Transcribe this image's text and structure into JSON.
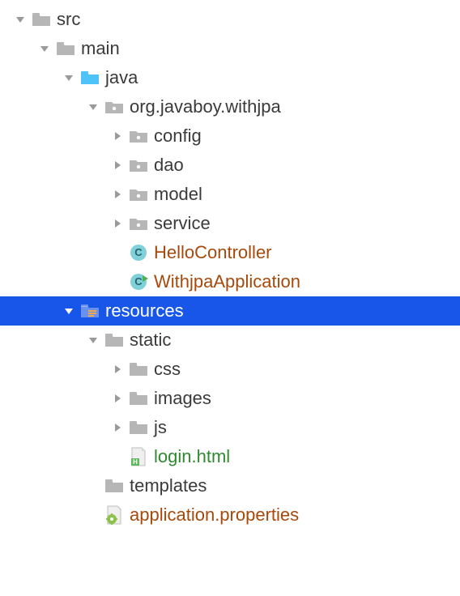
{
  "indent_unit": 30,
  "colors": {
    "selected_bg": "#1756e8",
    "java_class": "#a8490c",
    "html_file": "#2f8a2f",
    "props_file": "#a8490c",
    "folder_gray": "#b6b6b6",
    "folder_blue": "#4fc3f7",
    "package": "#b6b6b6"
  },
  "tree": [
    {
      "depth": 0,
      "arrow": "down",
      "icon": "folder-gray",
      "label": "src",
      "name": "folder-src",
      "interactable": true
    },
    {
      "depth": 1,
      "arrow": "down",
      "icon": "folder-gray",
      "label": "main",
      "name": "folder-main",
      "interactable": true
    },
    {
      "depth": 2,
      "arrow": "down",
      "icon": "folder-blue",
      "label": "java",
      "name": "folder-java",
      "interactable": true
    },
    {
      "depth": 3,
      "arrow": "down",
      "icon": "package",
      "label": "org.javaboy.withjpa",
      "name": "package-root",
      "interactable": true
    },
    {
      "depth": 4,
      "arrow": "right",
      "icon": "package",
      "label": "config",
      "name": "package-config",
      "interactable": true
    },
    {
      "depth": 4,
      "arrow": "right",
      "icon": "package",
      "label": "dao",
      "name": "package-dao",
      "interactable": true
    },
    {
      "depth": 4,
      "arrow": "right",
      "icon": "package",
      "label": "model",
      "name": "package-model",
      "interactable": true
    },
    {
      "depth": 4,
      "arrow": "right",
      "icon": "package",
      "label": "service",
      "name": "package-service",
      "interactable": true
    },
    {
      "depth": 4,
      "arrow": "none",
      "icon": "java-class",
      "label": "HelloController",
      "name": "class-hellocontroller",
      "class": "java-class",
      "interactable": true
    },
    {
      "depth": 4,
      "arrow": "none",
      "icon": "java-class-run",
      "label": "WithjpaApplication",
      "name": "class-withjpaapplication",
      "class": "java-class",
      "interactable": true
    },
    {
      "depth": 2,
      "arrow": "down",
      "icon": "resources",
      "label": "resources",
      "name": "folder-resources",
      "interactable": true,
      "selected": true
    },
    {
      "depth": 3,
      "arrow": "down",
      "icon": "folder-gray",
      "label": "static",
      "name": "folder-static",
      "interactable": true
    },
    {
      "depth": 4,
      "arrow": "right",
      "icon": "folder-gray",
      "label": "css",
      "name": "folder-css",
      "interactable": true
    },
    {
      "depth": 4,
      "arrow": "right",
      "icon": "folder-gray",
      "label": "images",
      "name": "folder-images",
      "interactable": true
    },
    {
      "depth": 4,
      "arrow": "right",
      "icon": "folder-gray",
      "label": "js",
      "name": "folder-js",
      "interactable": true
    },
    {
      "depth": 4,
      "arrow": "none",
      "icon": "html-file",
      "label": "login.html",
      "name": "file-login-html",
      "class": "html-file",
      "interactable": true
    },
    {
      "depth": 3,
      "arrow": "none",
      "icon": "folder-gray",
      "label": "templates",
      "name": "folder-templates",
      "interactable": true
    },
    {
      "depth": 3,
      "arrow": "none",
      "icon": "props-file",
      "label": "application.properties",
      "name": "file-application-properties",
      "class": "props-file",
      "interactable": true
    }
  ]
}
